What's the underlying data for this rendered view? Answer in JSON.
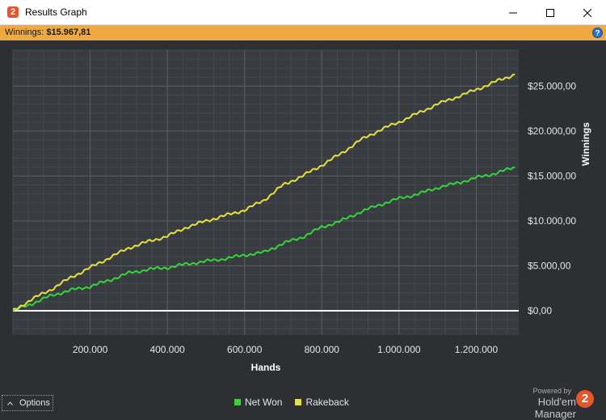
{
  "window": {
    "title": "Results Graph",
    "app_icon_text": "2",
    "minimize_icon": "minimize-icon",
    "maximize_icon": "maximize-icon",
    "close_icon": "close-icon"
  },
  "infobar": {
    "label": "Winnings:",
    "value": "$15.967,81",
    "help_text": "?"
  },
  "footer": {
    "options_label": "Options",
    "options_icon": "chevron-up-icon",
    "powered_by": "Powered by",
    "brand": "Hold'em Manager",
    "brand_logo_text": "2"
  },
  "colors": {
    "net_won": "#35d43a",
    "rakeback": "#e6e23a",
    "zero_line": "#ffffff",
    "accent": "#f0a840",
    "background": "#2d2f33"
  },
  "chart_data": {
    "type": "line",
    "title": "",
    "xlabel": "Hands",
    "ylabel": "Winnings",
    "xlim": [
      0,
      1310000
    ],
    "ylim": [
      -2700,
      29000
    ],
    "x_ticks": [
      200000,
      400000,
      600000,
      800000,
      1000000,
      1200000
    ],
    "x_tick_labels": [
      "200.000",
      "400.000",
      "600.000",
      "800.000",
      "1.000.000",
      "1.200.000"
    ],
    "y_ticks": [
      0,
      5000,
      10000,
      15000,
      20000,
      25000
    ],
    "y_tick_labels": [
      "$0,00",
      "$5.000,00",
      "$10.000,00",
      "$15.000,00",
      "$20.000,00",
      "$25.000,00"
    ],
    "y_axis_side": "right",
    "grid": true,
    "legend": "bottom-center",
    "series": [
      {
        "name": "Net Won",
        "x": [
          0,
          50000,
          100000,
          150000,
          200000,
          250000,
          300000,
          350000,
          400000,
          450000,
          500000,
          550000,
          600000,
          650000,
          700000,
          750000,
          800000,
          850000,
          900000,
          950000,
          1000000,
          1050000,
          1100000,
          1150000,
          1200000,
          1250000,
          1300000
        ],
        "y": [
          0,
          800,
          1700,
          2300,
          2700,
          3400,
          4200,
          4600,
          4800,
          5200,
          5500,
          5800,
          6200,
          6500,
          7500,
          8200,
          9300,
          10000,
          11000,
          11800,
          12500,
          13000,
          13700,
          14200,
          14800,
          15300,
          15968
        ]
      },
      {
        "name": "Rakeback",
        "x": [
          0,
          50000,
          100000,
          150000,
          200000,
          250000,
          300000,
          350000,
          400000,
          450000,
          500000,
          550000,
          600000,
          650000,
          700000,
          750000,
          800000,
          850000,
          900000,
          950000,
          1000000,
          1050000,
          1100000,
          1150000,
          1200000,
          1250000,
          1300000
        ],
        "y": [
          0,
          1300,
          2400,
          3700,
          4800,
          5900,
          7000,
          7700,
          8300,
          9300,
          10000,
          10600,
          11200,
          12300,
          14000,
          15000,
          16200,
          17500,
          19000,
          20100,
          21000,
          22000,
          23000,
          23800,
          24600,
          25500,
          26300
        ]
      }
    ]
  }
}
